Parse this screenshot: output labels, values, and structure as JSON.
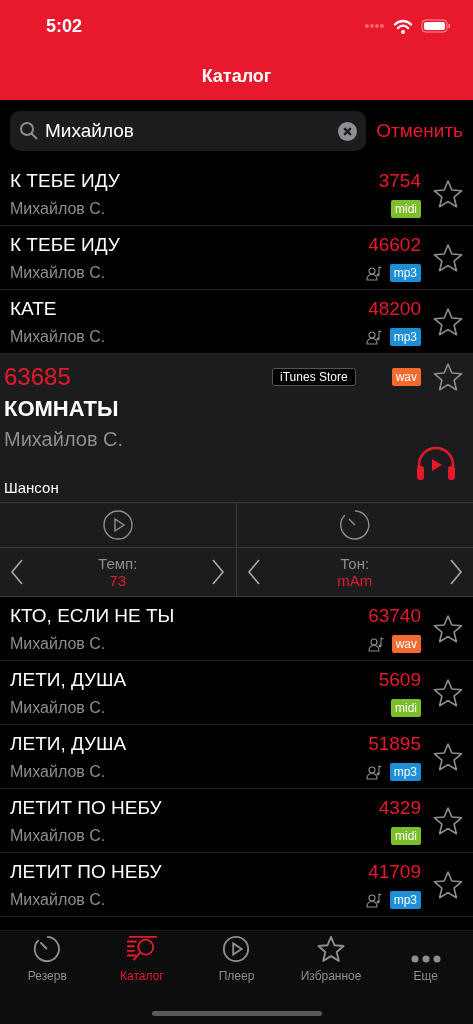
{
  "status_bar": {
    "time": "5:02"
  },
  "nav": {
    "title": "Каталог"
  },
  "search": {
    "value": "Михайлов",
    "cancel": "Отменить"
  },
  "songs_before": [
    {
      "title": "К ТЕБЕ ИДУ",
      "artist": "Михайлов С.",
      "number": "3754",
      "format": "midi",
      "color": "#7cbd2a",
      "vocal": false,
      "favorite": false
    },
    {
      "title": "К ТЕБЕ ИДУ",
      "artist": "Михайлов С.",
      "number": "46602",
      "format": "mp3",
      "color": "#1d8fd6",
      "vocal": true,
      "favorite": false
    },
    {
      "title": "КАТЕ",
      "artist": "Михайлов С.",
      "number": "48200",
      "format": "mp3",
      "color": "#1d8fd6",
      "vocal": true,
      "favorite": false
    }
  ],
  "expanded_song": {
    "number": "63685",
    "store": "iTunes Store",
    "format": "wav",
    "color": "#f26a2e",
    "favorite": false,
    "title": "КОМНАТЫ",
    "artist": "Михайлов С.",
    "genre": "Шансон",
    "tempo": {
      "label": "Темп:",
      "value": "73"
    },
    "key": {
      "label": "Тон:",
      "value": "mAm"
    }
  },
  "songs_after": [
    {
      "title": "КТО, ЕСЛИ НЕ ТЫ",
      "artist": "Михайлов С.",
      "number": "63740",
      "format": "wav",
      "color": "#f26a2e",
      "vocal": true,
      "favorite": false
    },
    {
      "title": "ЛЕТИ, ДУША",
      "artist": "Михайлов С.",
      "number": "5609",
      "format": "midi",
      "color": "#7cbd2a",
      "vocal": false,
      "favorite": false
    },
    {
      "title": "ЛЕТИ, ДУША",
      "artist": "Михайлов С.",
      "number": "51895",
      "format": "mp3",
      "color": "#1d8fd6",
      "vocal": true,
      "favorite": false
    },
    {
      "title": "ЛЕТИТ ПО НЕБУ",
      "artist": "Михайлов С.",
      "number": "4329",
      "format": "midi",
      "color": "#7cbd2a",
      "vocal": false,
      "favorite": false
    },
    {
      "title": "ЛЕТИТ ПО НЕБУ",
      "artist": "Михайлов С.",
      "number": "41709",
      "format": "mp3",
      "color": "#1d8fd6",
      "vocal": true,
      "favorite": false
    }
  ],
  "tab_bar": [
    {
      "kind": "timer",
      "label": "Резерв",
      "selected": false
    },
    {
      "kind": "catalog",
      "label": "Каталог",
      "selected": true
    },
    {
      "kind": "play",
      "label": "Плеер",
      "selected": false
    },
    {
      "kind": "star",
      "label": "Избранное",
      "selected": false
    },
    {
      "kind": "more",
      "label": "Еще",
      "selected": false
    }
  ]
}
